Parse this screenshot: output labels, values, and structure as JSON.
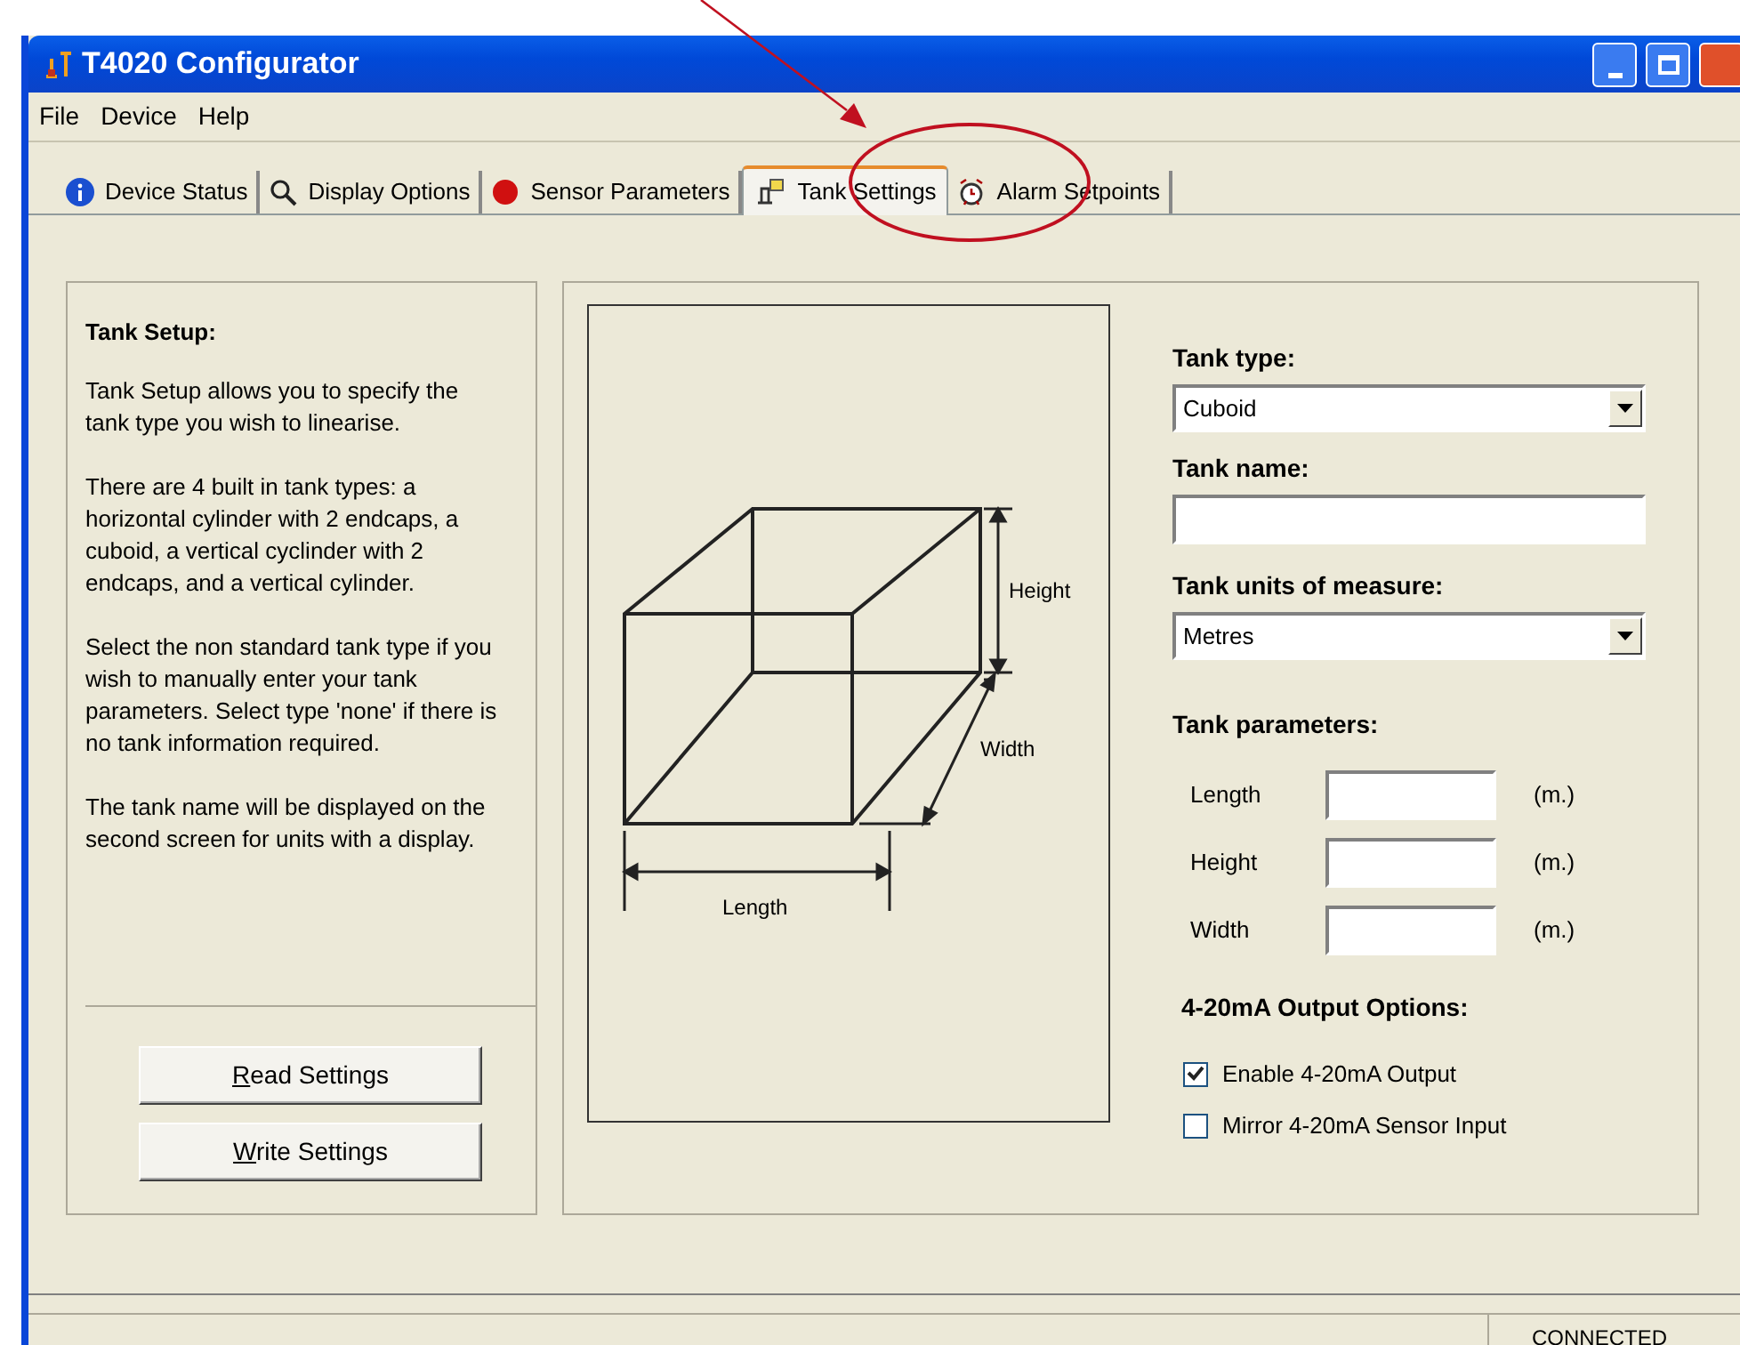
{
  "window": {
    "title": "T4020 Configurator"
  },
  "menu": [
    "File",
    "Device",
    "Help"
  ],
  "tabs": [
    {
      "label": "Device Status",
      "selected": false
    },
    {
      "label": "Display Options",
      "selected": false
    },
    {
      "label": "Sensor Parameters",
      "selected": false
    },
    {
      "label": "Tank Settings",
      "selected": true
    },
    {
      "label": "Alarm Setpoints",
      "selected": false
    }
  ],
  "help_panel": {
    "title": "Tank Setup:",
    "paragraphs": [
      "Tank Setup allows you to specify the tank type you wish to linearise.",
      "There are 4 built in tank types: a horizontal cylinder with 2 endcaps, a cuboid, a vertical cyclinder with 2 endcaps, and a vertical cylinder.",
      "Select the non standard tank type if you wish to manually enter your tank parameters.  Select type 'none' if there is no tank information required.",
      "The tank name will be displayed on the second screen for units with a display."
    ],
    "buttons": [
      {
        "access_key": "R",
        "label_rest": "ead Settings"
      },
      {
        "access_key": "W",
        "label_rest": "rite Settings"
      }
    ]
  },
  "diagram": {
    "height_label": "Height",
    "width_label": "Width",
    "length_label": "Length"
  },
  "form": {
    "tank_type": {
      "label": "Tank type:",
      "value": "Cuboid"
    },
    "tank_name": {
      "label": "Tank name:"
    },
    "units": {
      "label": "Tank units of measure:",
      "value": "Metres"
    },
    "parameters_title": "Tank parameters:",
    "parameters": [
      {
        "label": "Length",
        "unit": "(m.)"
      },
      {
        "label": "Height",
        "unit": "(m.)"
      },
      {
        "label": "Width",
        "unit": "(m.)"
      }
    ],
    "output_title": "4-20mA Output Options:",
    "options": [
      {
        "label": "Enable 4-20mA Output",
        "checked": true
      },
      {
        "label": "Mirror 4-20mA Sensor Input",
        "checked": false
      }
    ]
  },
  "status_bar": {
    "connection": "CONNECTED"
  }
}
